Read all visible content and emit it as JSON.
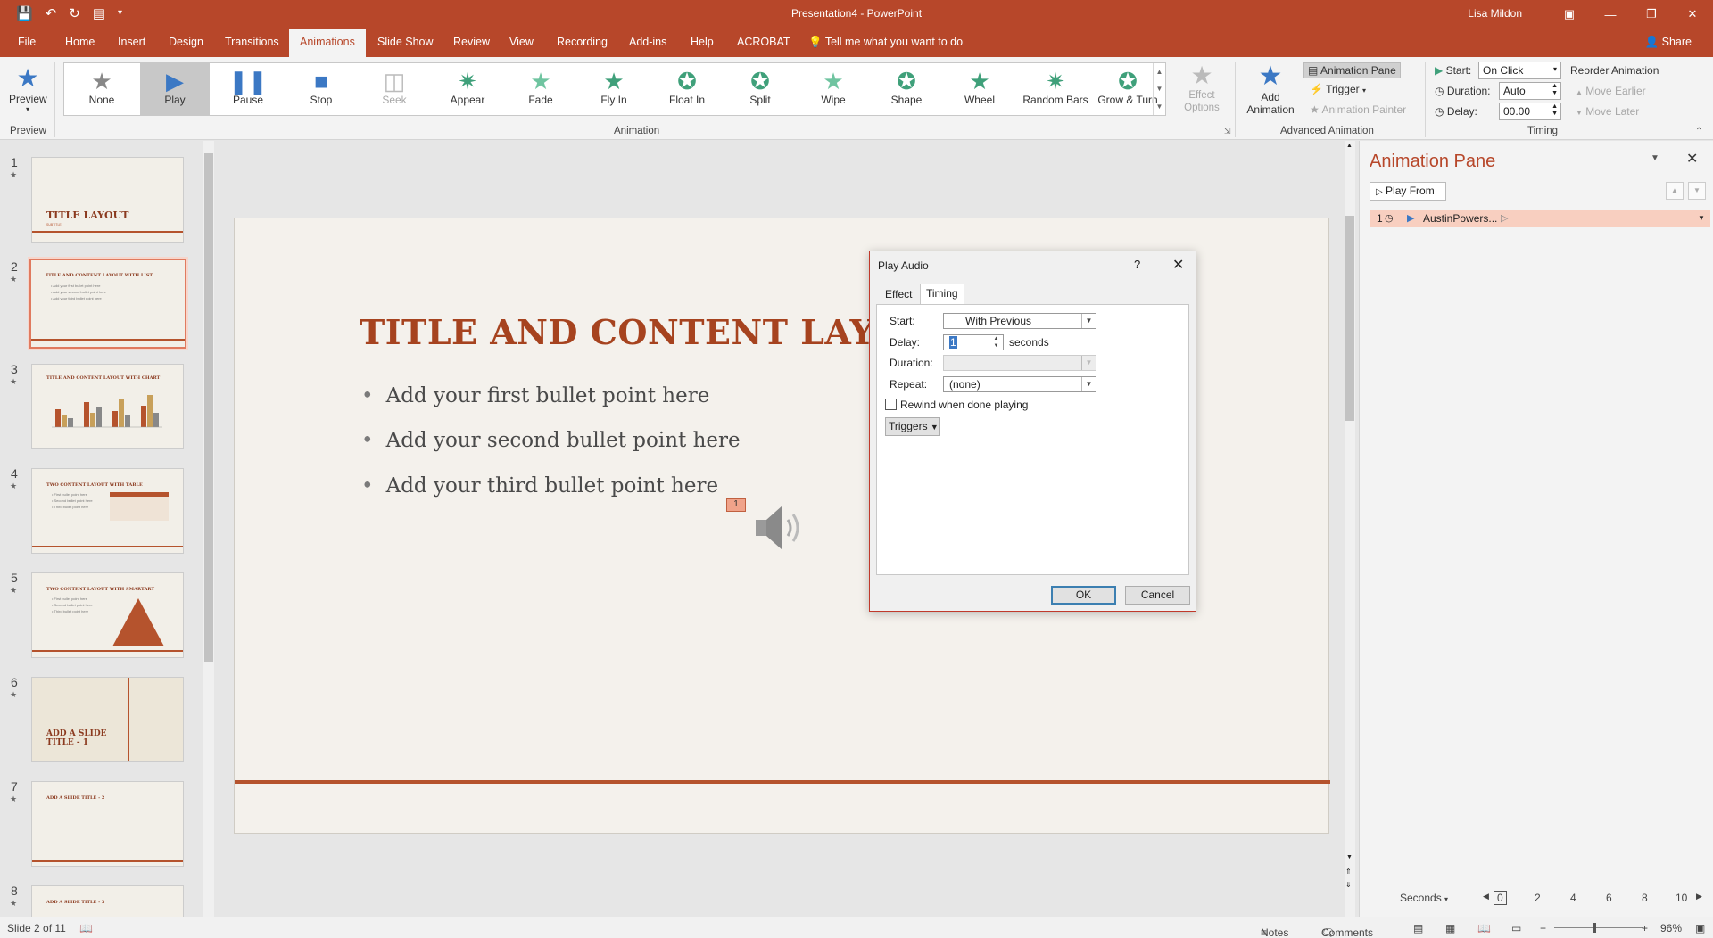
{
  "window": {
    "title": "Presentation4  -  PowerPoint",
    "user": "Lisa Mildon"
  },
  "colors": {
    "accent": "#b7472a",
    "slide_title": "#a6431f",
    "selection": "#f8cfc0"
  },
  "tabs": [
    "File",
    "Home",
    "Insert",
    "Design",
    "Transitions",
    "Animations",
    "Slide Show",
    "Review",
    "View",
    "Recording",
    "Add-ins",
    "Help",
    "ACROBAT"
  ],
  "active_tab": "Animations",
  "tell_me": "Tell me what you want to do",
  "share": "Share",
  "ribbon": {
    "preview": {
      "label": "Preview",
      "group": "Preview"
    },
    "animations": [
      "None",
      "Play",
      "Pause",
      "Stop",
      "Seek",
      "Appear",
      "Fade",
      "Fly In",
      "Float In",
      "Split",
      "Wipe",
      "Shape",
      "Wheel",
      "Random Bars",
      "Grow & Turn"
    ],
    "selected_animation": "Play",
    "effect_options": "Effect Options",
    "animation_group": "Animation",
    "add_animation": "Add Animation",
    "animation_pane": "Animation Pane",
    "trigger": "Trigger",
    "animation_painter": "Animation Painter",
    "advanced_group": "Advanced Animation",
    "start_label": "Start:",
    "start_value": "On Click",
    "duration_label": "Duration:",
    "duration_value": "Auto",
    "delay_label": "Delay:",
    "delay_value": "00.00",
    "reorder_label": "Reorder Animation",
    "move_earlier": "Move Earlier",
    "move_later": "Move Later",
    "timing_group": "Timing"
  },
  "thumbnails": [
    {
      "num": "1",
      "title": "TITLE LAYOUT",
      "subtitle": "SUBTITLE"
    },
    {
      "num": "2",
      "title": "TITLE AND CONTENT LAYOUT WITH LIST"
    },
    {
      "num": "3",
      "title": "TITLE AND CONTENT LAYOUT WITH CHART"
    },
    {
      "num": "4",
      "title": "TWO CONTENT LAYOUT WITH TABLE"
    },
    {
      "num": "5",
      "title": "TWO CONTENT LAYOUT WITH SMARTART"
    },
    {
      "num": "6",
      "title": "ADD A SLIDE TITLE - 1"
    },
    {
      "num": "7",
      "title": "ADD A SLIDE TITLE - 2"
    },
    {
      "num": "8",
      "title": "ADD A SLIDE TITLE - 3"
    }
  ],
  "slide": {
    "title": "TITLE AND CONTENT LAYOUT W",
    "bullets": [
      "Add your first bullet point here",
      "Add your second bullet point here",
      "Add your third bullet point here"
    ],
    "anim_tag": "1"
  },
  "dialog": {
    "title": "Play Audio",
    "help": "?",
    "tabs": [
      "Effect",
      "Timing"
    ],
    "active_tab": "Timing",
    "start_label": "Start:",
    "start_value": "With Previous",
    "delay_label": "Delay:",
    "delay_value": "1",
    "delay_unit": "seconds",
    "duration_label": "Duration:",
    "repeat_label": "Repeat:",
    "repeat_value": "(none)",
    "rewind_label": "Rewind when done playing",
    "triggers": "Triggers",
    "ok": "OK",
    "cancel": "Cancel"
  },
  "anim_pane": {
    "title": "Animation Pane",
    "play_from": "Play From",
    "item_num": "1",
    "item_name": "AustinPowers...",
    "timeline_label": "Seconds",
    "ticks": [
      "0",
      "2",
      "4",
      "6",
      "8",
      "10"
    ]
  },
  "status": {
    "slide_info": "Slide 2 of 11",
    "notes": "Notes",
    "comments": "Comments",
    "zoom": "96%"
  }
}
